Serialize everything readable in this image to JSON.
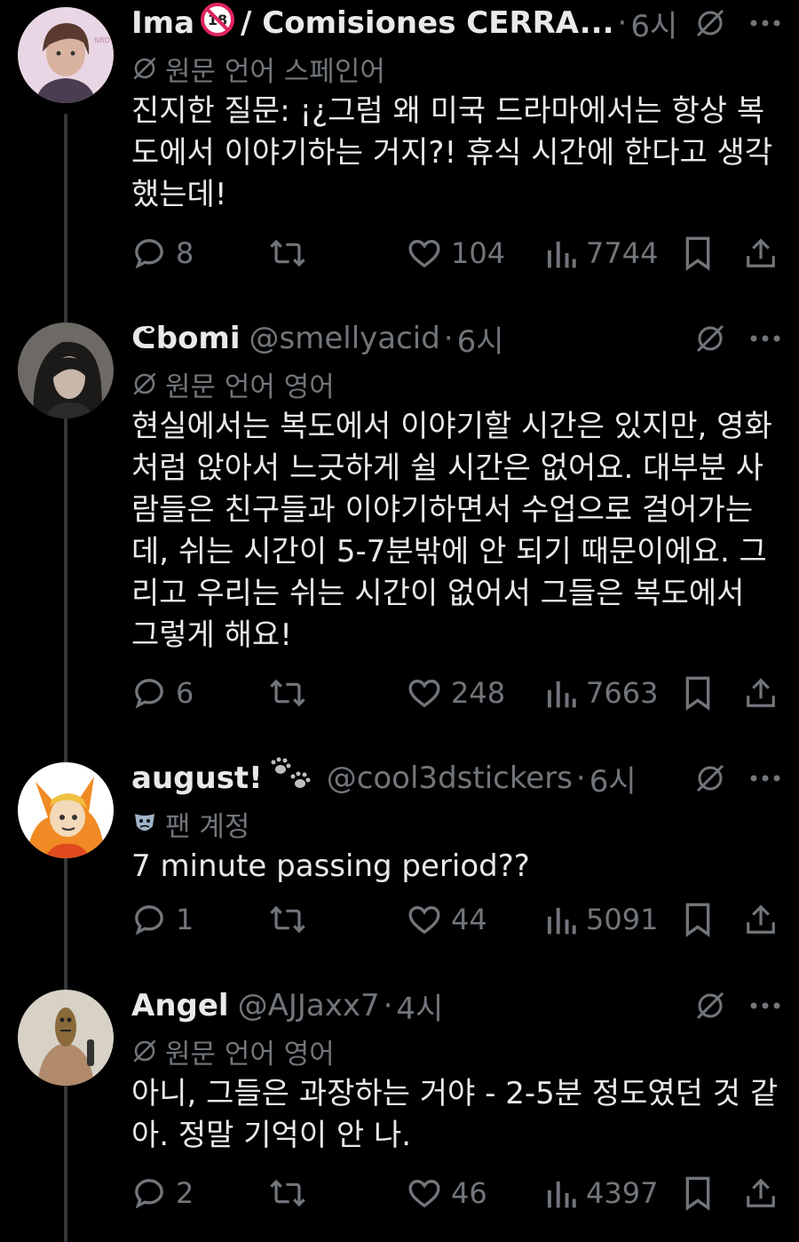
{
  "tweets": [
    {
      "name": "Ima",
      "name_suffix": "/ Comisiones CERRA...",
      "handle": "",
      "time": "6시",
      "translated": "원문 언어 스페인어",
      "text": "진지한 질문: ¡¿그럼 왜 미국 드라마에서는 항상 복도에서 이야기하는 거지?! 휴식 시간에 한다고 생각했는데!",
      "replies": "8",
      "retweets": "",
      "likes": "104",
      "views": "7744"
    },
    {
      "name": "ᕦbomi",
      "handle": "@smellyacid",
      "time": "6시",
      "translated": "원문 언어 영어",
      "text": "현실에서는 복도에서 이야기할 시간은 있지만, 영화처럼 앉아서 느긋하게 쉴 시간은 없어요. 대부분 사람들은 친구들과 이야기하면서 수업으로 걸어가는데, 쉬는 시간이 5-7분밖에 안 되기 때문이에요. 그리고 우리는 쉬는 시간이 없어서 그들은 복도에서 그렇게 해요!",
      "replies": "6",
      "retweets": "",
      "likes": "248",
      "views": "7663"
    },
    {
      "name": "august!",
      "handle": "@cool3dstickers",
      "time": "6시",
      "fan_label": "팬 계정",
      "text": "7 minute passing period??",
      "replies": "1",
      "retweets": "",
      "likes": "44",
      "views": "5091"
    },
    {
      "name": "Angel",
      "handle": "@AJJaxx7",
      "time": "4시",
      "translated": "원문 언어 영어",
      "text": "아니, 그들은 과장하는 거야 - 2-5분 정도였던 것 같아. 정말 기억이 안 나.",
      "replies": "2",
      "retweets": "",
      "likes": "46",
      "views": "4397"
    }
  ],
  "icons": {
    "no_translate": "grok-slash-icon",
    "more": "more-icon",
    "reply": "reply-icon",
    "retweet": "retweet-icon",
    "like": "like-icon",
    "views": "views-icon",
    "bookmark": "bookmark-icon",
    "share": "share-icon",
    "badge_18": "no-under-18-icon",
    "paws": "paw-prints-icon",
    "mask": "theater-mask-icon"
  },
  "colors": {
    "background": "#000000",
    "text": "#e7e9ea",
    "muted": "#71767b",
    "thread_line": "#333639"
  }
}
